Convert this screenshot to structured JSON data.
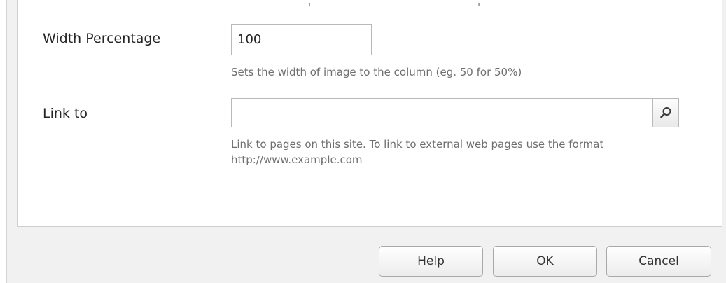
{
  "form": {
    "width_percentage": {
      "label": "Width Percentage",
      "value": "100",
      "hint": "Sets the width of image to the column (eg. 50 for 50%)"
    },
    "link_to": {
      "label": "Link to",
      "value": "",
      "placeholder": "",
      "hint": "Link to pages on this site. To link to external web pages use the format http://www.example.com",
      "picker_icon": "search-icon"
    }
  },
  "buttons": {
    "help": "Help",
    "ok": "OK",
    "cancel": "Cancel"
  },
  "colors": {
    "dialog_background": "#f1f1f1",
    "panel_background": "#ffffff",
    "hint_text": "#6f6f6f",
    "border": "#b9b9b9"
  }
}
